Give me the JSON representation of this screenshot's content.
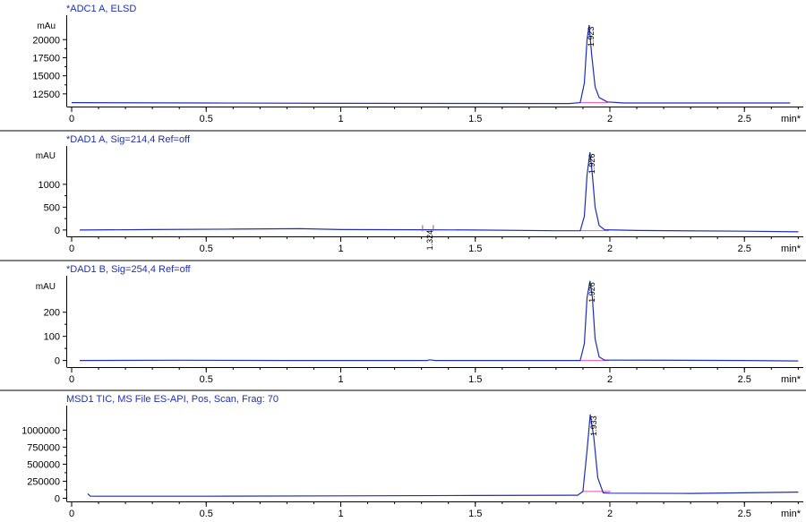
{
  "chart_data": [
    {
      "type": "line",
      "title": "*ADC1 A, ELSD",
      "ylabel": "mAu",
      "xlabel": "min*",
      "xlim": [
        0,
        2.7
      ],
      "ylim": [
        11000,
        23000
      ],
      "x_ticks": [
        "0",
        "0.5",
        "1",
        "1.5",
        "2",
        "2.5"
      ],
      "y_ticks": [
        12500,
        15000,
        17500,
        20000
      ],
      "peaks": [
        {
          "label": "1.923",
          "x": 1.923,
          "y": 22000
        }
      ],
      "series": [
        {
          "color": "#1f2fb4",
          "points": [
            [
              0,
              11300
            ],
            [
              0.5,
              11250
            ],
            [
              1.0,
              11200
            ],
            [
              1.5,
              11180
            ],
            [
              1.85,
              11170
            ],
            [
              1.89,
              11300
            ],
            [
              1.905,
              14000
            ],
            [
              1.915,
              20000
            ],
            [
              1.923,
              22000
            ],
            [
              1.932,
              18000
            ],
            [
              1.945,
              13500
            ],
            [
              1.96,
              12000
            ],
            [
              1.99,
              11400
            ],
            [
              2.05,
              11250
            ],
            [
              2.5,
              11250
            ],
            [
              2.67,
              11250
            ]
          ]
        }
      ]
    },
    {
      "type": "line",
      "title": "*DAD1 A, Sig=214,4 Ref=off",
      "ylabel": "mAU",
      "xlabel": "min*",
      "xlim": [
        0,
        2.7
      ],
      "ylim": [
        -100,
        1800
      ],
      "x_ticks": [
        "0",
        "0.5",
        "1",
        "1.5",
        "2",
        "2.5"
      ],
      "y_ticks": [
        0,
        500,
        1000
      ],
      "peaks": [
        {
          "label": "1.926",
          "x": 1.926,
          "y": 1700
        },
        {
          "label": "1.324",
          "x": 1.324,
          "y": 30
        }
      ],
      "series": [
        {
          "color": "#1f2fb4",
          "points": [
            [
              0.03,
              0
            ],
            [
              0.3,
              10
            ],
            [
              0.6,
              20
            ],
            [
              0.85,
              30
            ],
            [
              1.0,
              10
            ],
            [
              1.3,
              5
            ],
            [
              1.5,
              0
            ],
            [
              1.8,
              -15
            ],
            [
              1.89,
              -15
            ],
            [
              1.905,
              300
            ],
            [
              1.915,
              1200
            ],
            [
              1.926,
              1700
            ],
            [
              1.935,
              1200
            ],
            [
              1.945,
              500
            ],
            [
              1.96,
              100
            ],
            [
              1.98,
              5
            ],
            [
              2.1,
              -10
            ],
            [
              2.5,
              -25
            ],
            [
              2.7,
              -40
            ]
          ]
        }
      ]
    },
    {
      "type": "line",
      "title": "*DAD1 B, Sig=254,4 Ref=off",
      "ylabel": "mAU",
      "xlabel": "min*",
      "xlim": [
        0,
        2.7
      ],
      "ylim": [
        -20,
        340
      ],
      "x_ticks": [
        "0",
        "0.5",
        "1",
        "1.5",
        "2",
        "2.5"
      ],
      "y_ticks": [
        0,
        100,
        200
      ],
      "peaks": [
        {
          "label": "1.926",
          "x": 1.926,
          "y": 330
        }
      ],
      "series": [
        {
          "color": "#1f2fb4",
          "points": [
            [
              0.03,
              0
            ],
            [
              0.4,
              1
            ],
            [
              0.8,
              0
            ],
            [
              1.32,
              0
            ],
            [
              1.33,
              3
            ],
            [
              1.35,
              0
            ],
            [
              1.89,
              0
            ],
            [
              1.905,
              70
            ],
            [
              1.915,
              260
            ],
            [
              1.926,
              330
            ],
            [
              1.935,
              260
            ],
            [
              1.945,
              90
            ],
            [
              1.96,
              15
            ],
            [
              1.98,
              2
            ],
            [
              2.5,
              0
            ],
            [
              2.7,
              -2
            ]
          ]
        }
      ]
    },
    {
      "type": "line",
      "title": "MSD1 TIC, MS File     ES-API, Pos, Scan, Frag: 70",
      "ylabel": "",
      "xlabel": "min*",
      "xlim": [
        0,
        2.7
      ],
      "ylim": [
        -20000,
        1320000
      ],
      "x_ticks": [
        "0",
        "0.5",
        "1",
        "1.5",
        "2",
        "2.5"
      ],
      "y_ticks": [
        0,
        250000,
        500000,
        750000,
        1000000
      ],
      "peaks": [
        {
          "label": "1.933",
          "x": 1.933,
          "y": 1230000
        }
      ],
      "series": [
        {
          "color": "#1f2fb4",
          "points": [
            [
              0.06,
              65000
            ],
            [
              0.07,
              30000
            ],
            [
              0.5,
              30000
            ],
            [
              1.0,
              35000
            ],
            [
              1.5,
              40000
            ],
            [
              1.88,
              45000
            ],
            [
              1.9,
              100000
            ],
            [
              1.915,
              700000
            ],
            [
              1.927,
              1230000
            ],
            [
              1.94,
              900000
            ],
            [
              1.955,
              300000
            ],
            [
              1.975,
              80000
            ],
            [
              2.0,
              75000
            ],
            [
              2.3,
              70000
            ],
            [
              2.5,
              80000
            ],
            [
              2.7,
              90000
            ]
          ]
        }
      ]
    }
  ]
}
